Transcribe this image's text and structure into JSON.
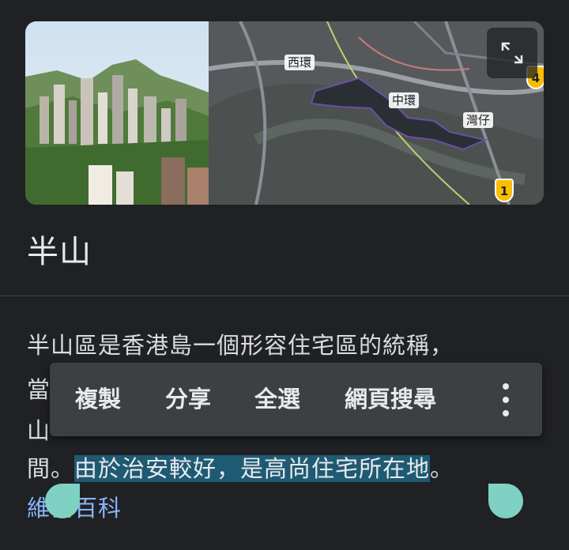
{
  "media": {
    "map_labels": {
      "sai_wan": "西環",
      "central": "中環",
      "wan_chai": "灣仔"
    },
    "route_badges": {
      "top": "4",
      "bottom": "1"
    }
  },
  "title": "半山",
  "description": {
    "line1": "半山區是香港島一個形容住宅區的統稱，",
    "line2_visible": "當",
    "line3_visible": "山",
    "line4_prefix": "間。",
    "line4_selected": "由於治安較好，是高尚住宅所在地",
    "line4_suffix": "。"
  },
  "source_link": "維基百科",
  "context_menu": {
    "copy": "複製",
    "share": "分享",
    "select_all": "全選",
    "web_search": "網頁搜尋"
  },
  "colors": {
    "background": "#202124",
    "selection": "#1f5a73",
    "handle": "#7fd1c3",
    "link": "#8ab4f8",
    "menu": "#3c4043"
  }
}
